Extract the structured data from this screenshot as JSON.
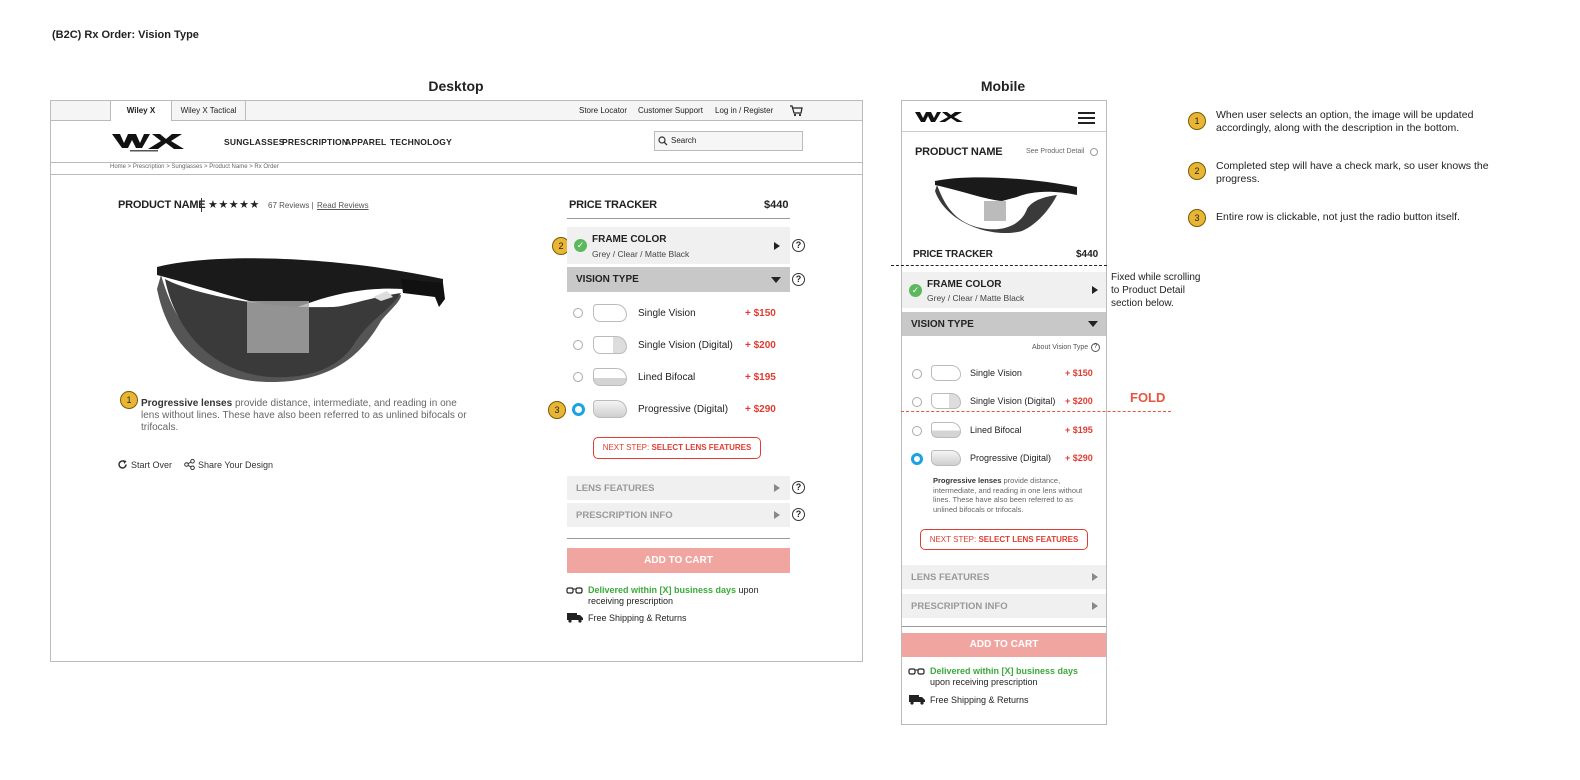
{
  "page_title": "(B2C) Rx Order: Vision Type",
  "sections": {
    "desktop": "Desktop",
    "mobile": "Mobile"
  },
  "topbar": {
    "brand_tabs": [
      "Wiley X",
      "Wiley X Tactical"
    ],
    "links": [
      "Store Locator",
      "Customer Support",
      "Log in / Register"
    ]
  },
  "nav": {
    "items": [
      "SUNGLASSES",
      "PRESCRIPTION",
      "APPAREL",
      "TECHNOLOGY"
    ],
    "search_placeholder": "Search"
  },
  "breadcrumb": "Home > Prescription > Sunglasses > Product Name > Rx Order",
  "product": {
    "name": "PRODUCT NAME",
    "stars": "★★★★★",
    "reviews": "67 Reviews |",
    "read_reviews": "Read Reviews",
    "desc_bold": "Progressive lenses",
    "desc_rest": " provide distance, intermediate, and reading in one lens without lines. These have also been referred to as unlined bifocals or trifocals.",
    "start_over": "Start Over",
    "share": "Share Your Design"
  },
  "tracker": {
    "title": "PRICE TRACKER",
    "price": "$440",
    "frame_color": {
      "title": "FRAME COLOR",
      "value": "Grey / Clear / Matte Black",
      "complete": true
    },
    "vision_type": {
      "title": "VISION TYPE"
    },
    "options": [
      {
        "label": "Single Vision",
        "price": "+ $150",
        "selected": false,
        "icon": "lens-single-icon"
      },
      {
        "label": "Single Vision (Digital)",
        "price": "+ $200",
        "selected": false,
        "icon": "lens-digital-icon"
      },
      {
        "label": "Lined Bifocal",
        "price": "+ $195",
        "selected": false,
        "icon": "lens-bifocal-icon"
      },
      {
        "label": "Progressive (Digital)",
        "price": "+ $290",
        "selected": true,
        "icon": "lens-progressive-icon"
      }
    ],
    "next_step_prefix": "NEXT STEP: ",
    "next_step_label": "SELECT LENS FEATURES",
    "lens_features": "LENS FEATURES",
    "prescription_info": "PRESCRIPTION INFO",
    "add_to_cart": "ADD TO CART",
    "delivery_green": "Delivered within [X] business days",
    "delivery_rest": " upon receiving prescription",
    "shipping": "Free Shipping & Returns"
  },
  "mobile": {
    "see_detail": "See Product Detail",
    "about_vision": "About Vision Type",
    "desc_bold": "Progressive lenses",
    "desc_rest": " provide distance, intermediate, and reading in one lens without lines. These have also been referred to as unlined bifocals or trifocals.",
    "fixed_note": "Fixed while scrolling to Product Detail section below.",
    "fold": "FOLD"
  },
  "annotations": [
    {
      "n": "1",
      "text": "When user selects an option, the image will be updated accordingly, along with the description in the bottom."
    },
    {
      "n": "2",
      "text": "Completed step will have a check mark, so user knows the progress."
    },
    {
      "n": "3",
      "text": "Entire row is clickable, not just the radio button itself."
    }
  ],
  "colors": {
    "accent_red": "#e03c31",
    "check_green": "#5cb85c",
    "radio_blue": "#1aa3e0",
    "badge_yellow": "#e8b634",
    "cart_pink": "#f1a5a0"
  }
}
